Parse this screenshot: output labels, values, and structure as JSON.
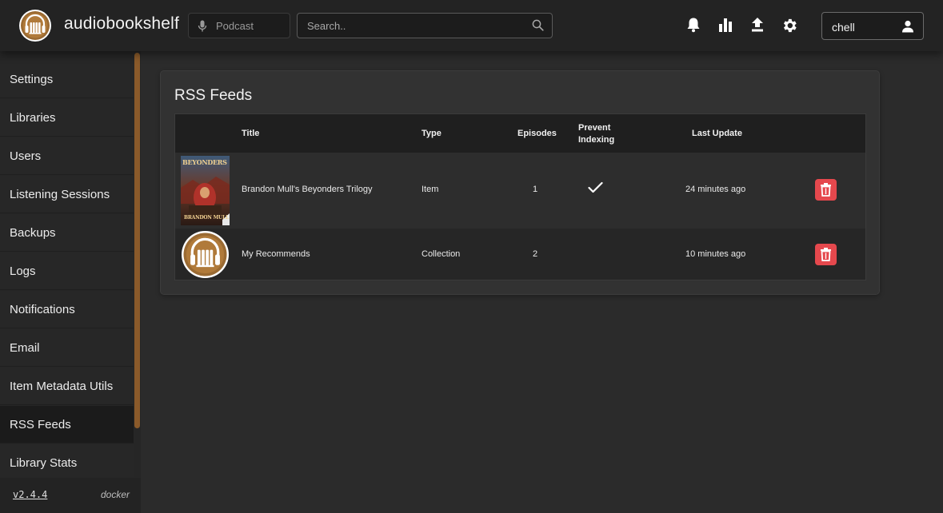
{
  "app": {
    "title": "audiobookshelf",
    "logo_icon": "headphones-books-icon",
    "accent_color": "#8a5a2a"
  },
  "header": {
    "library_label": "Podcast",
    "library_icon": "microphone-icon",
    "search_placeholder": "Search..",
    "icons": [
      "bell-icon",
      "stats-icon",
      "upload-icon",
      "gear-icon"
    ],
    "user_name": "chell"
  },
  "sidebar": {
    "items": [
      {
        "label": "Settings"
      },
      {
        "label": "Libraries"
      },
      {
        "label": "Users"
      },
      {
        "label": "Listening Sessions"
      },
      {
        "label": "Backups"
      },
      {
        "label": "Logs"
      },
      {
        "label": "Notifications"
      },
      {
        "label": "Email"
      },
      {
        "label": "Item Metadata Utils"
      },
      {
        "label": "RSS Feeds"
      },
      {
        "label": "Library Stats"
      }
    ],
    "active_index": 9,
    "version": "v2.4.4",
    "install_source": "docker"
  },
  "main": {
    "title": "RSS Feeds",
    "columns": {
      "title": "Title",
      "type": "Type",
      "episodes": "Episodes",
      "prevent_indexing_line1": "Prevent",
      "prevent_indexing_line2": "Indexing",
      "last_update": "Last Update"
    },
    "rows": [
      {
        "cover_text_top": "BEYONDERS",
        "cover_text_bottom": "BRANDON MULL",
        "title": "Brandon Mull's Beyonders Trilogy",
        "type": "Item",
        "episodes": "1",
        "prevent_indexing": true,
        "last_update": "24 minutes ago"
      },
      {
        "title": "My Recommends",
        "type": "Collection",
        "episodes": "2",
        "prevent_indexing": false,
        "last_update": "10 minutes ago"
      }
    ],
    "delete_color": "#e5484d"
  }
}
